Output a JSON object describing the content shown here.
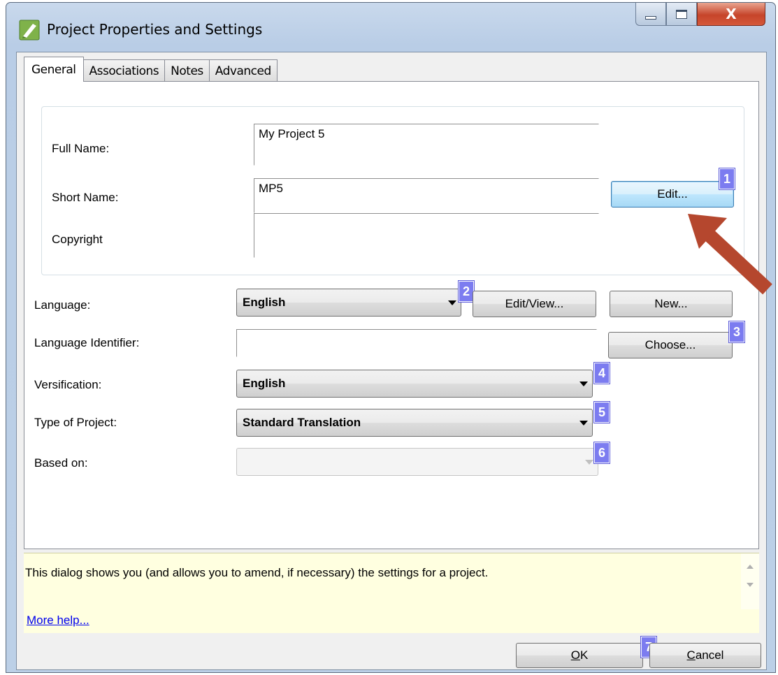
{
  "window": {
    "title": "Project Properties and Settings",
    "minimize_icon": "minimize-icon",
    "maximize_icon": "maximize-icon",
    "close_icon": "close-icon",
    "close_glyph": "X"
  },
  "tabs": [
    {
      "label": "General",
      "active": true
    },
    {
      "label": "Associations",
      "active": false
    },
    {
      "label": "Notes",
      "active": false
    },
    {
      "label": "Advanced",
      "active": false
    }
  ],
  "general": {
    "full_name_label": "Full Name:",
    "full_name_value": "My Project 5",
    "short_name_label": "Short Name:",
    "short_name_value": "MP5",
    "edit_button": "Edit...",
    "copyright_label": "Copyright",
    "copyright_value": "",
    "language_label": "Language:",
    "language_value": "English",
    "edit_view_button": "Edit/View...",
    "new_button": "New...",
    "language_identifier_label": "Language Identifier:",
    "language_identifier_value": "",
    "choose_button": "Choose...",
    "versification_label": "Versification:",
    "versification_value": "English",
    "type_label": "Type of Project:",
    "type_value": "Standard Translation",
    "based_on_label": "Based on:",
    "based_on_value": ""
  },
  "callouts": [
    "1",
    "2",
    "3",
    "4",
    "5",
    "6",
    "7"
  ],
  "help": {
    "text": "This dialog shows you (and allows you to amend, if necessary) the settings for a project.",
    "link": "More help..."
  },
  "footer": {
    "ok_mnemonic": "O",
    "ok_rest": "K",
    "cancel_mnemonic": "C",
    "cancel_rest": "ancel"
  },
  "colors": {
    "callout": "#7c7cf0",
    "arrow": "#b5472e",
    "help_bg": "#ffffe0"
  }
}
